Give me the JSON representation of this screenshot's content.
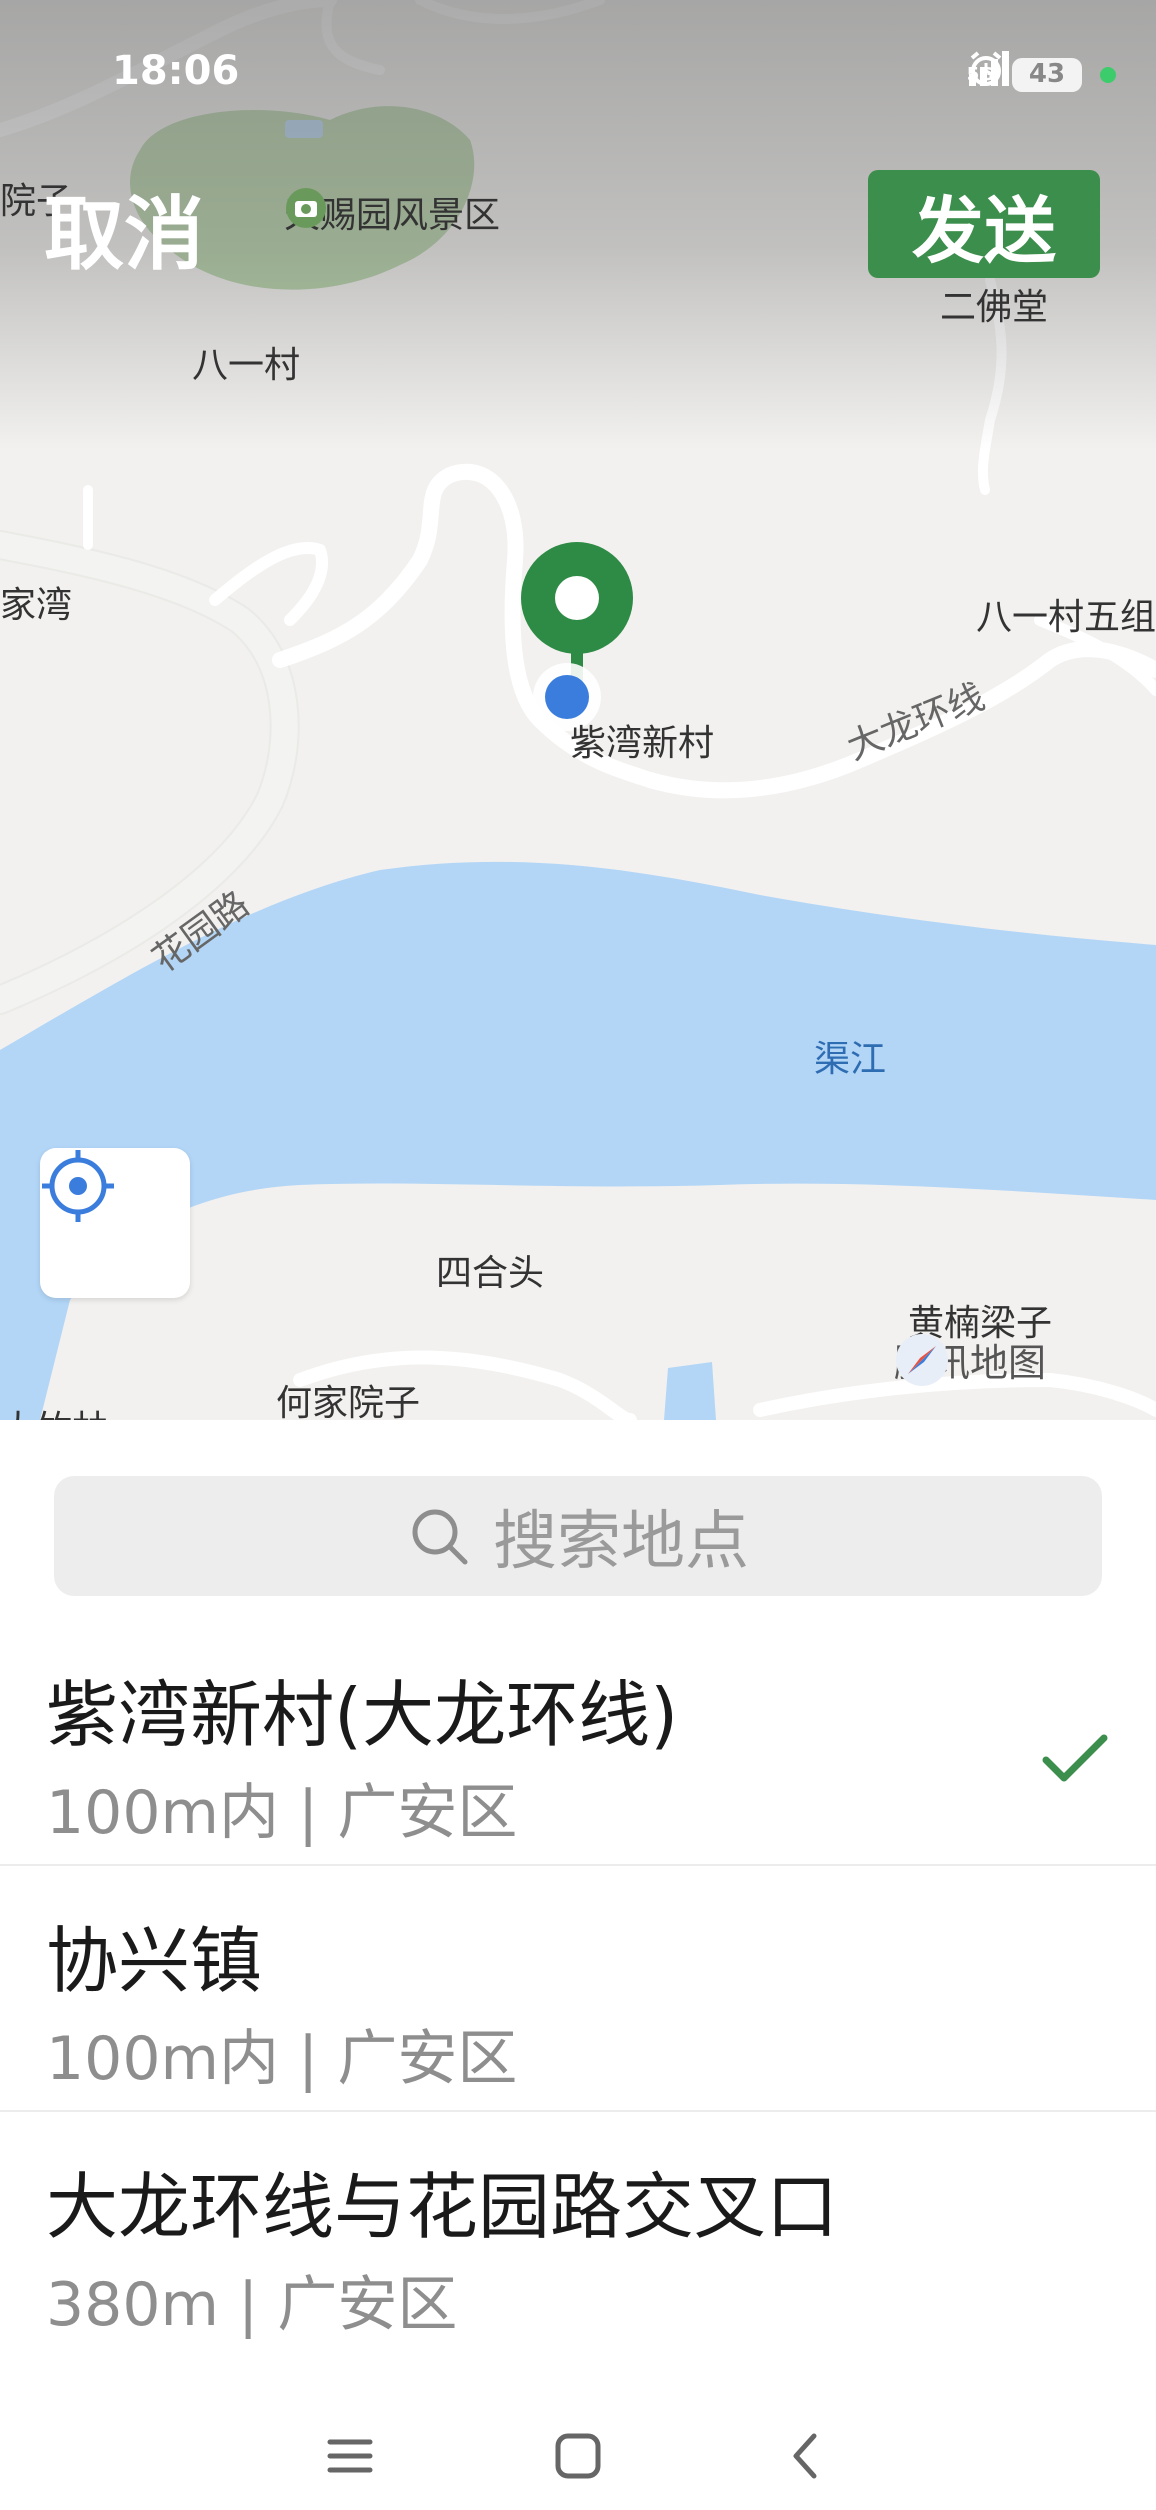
{
  "status_bar": {
    "time": "18:06",
    "network": "5G",
    "battery": "43"
  },
  "header": {
    "cancel_label": "取消",
    "send_label": "发送"
  },
  "map": {
    "poi_scenic": "天赐园风景区",
    "labels": {
      "yuanzi_left": "院子",
      "bayicun": "八一村",
      "erfotang": "二佛堂",
      "jiawan": "家湾",
      "bayicun_wu": "八一村五组",
      "ziwan": "紫湾新村",
      "dalong": "大龙环线",
      "huayuan": "花园路",
      "qujiang": "渠江",
      "sihetou": "四合头",
      "huangnan": "黄楠梁子",
      "hejia": "何家院子",
      "dazhu": "大竹林"
    },
    "provider": "腾讯地图"
  },
  "search": {
    "placeholder": "搜索地点"
  },
  "results": [
    {
      "title": "紫湾新村(大龙环线)",
      "subtitle": "100m内 | 广安区",
      "selected": true
    },
    {
      "title": "协兴镇",
      "subtitle": "100m内 | 广安区",
      "selected": false
    },
    {
      "title": "大龙环线与花园路交叉口",
      "subtitle": "380m | 广安区",
      "selected": false
    }
  ],
  "colors": {
    "accent": "#3c8e4c",
    "water": "#b3d6f7",
    "park": "#a4c994",
    "user_dot": "#3b7ddd"
  },
  "icons": {
    "search": "search-icon",
    "locate": "crosshair-icon",
    "check": "checkmark-icon",
    "camera": "camera-icon"
  }
}
